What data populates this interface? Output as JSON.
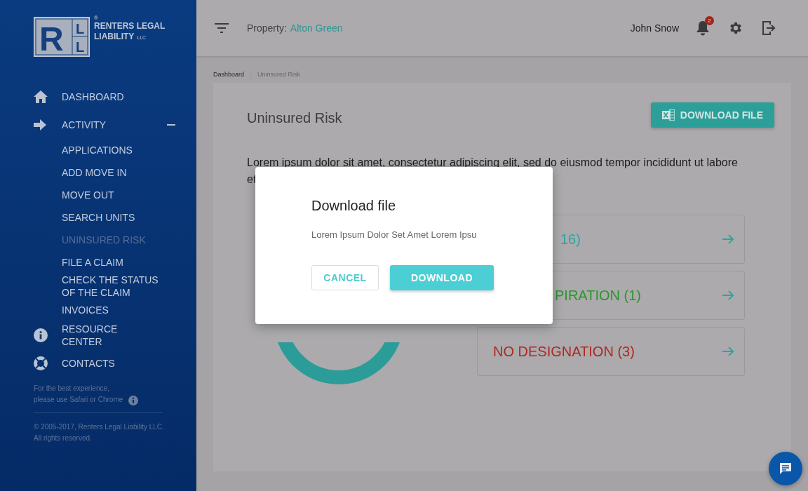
{
  "sidebar": {
    "logo": {
      "letters": [
        "R",
        "L",
        "L"
      ],
      "mark": "®",
      "name_lines": [
        "RENTERS LEGAL",
        "LIABILITY"
      ],
      "suffix": "LLC"
    },
    "nav": [
      {
        "label": "DASHBOARD"
      },
      {
        "label": "ACTIVITY",
        "expanded": true,
        "children": [
          {
            "label": "APPLICATIONS",
            "selected": false
          },
          {
            "label": "ADD MOVE IN",
            "selected": false
          },
          {
            "label": "MOVE OUT",
            "selected": false
          },
          {
            "label": "SEARCH UNITS",
            "selected": false
          },
          {
            "label": "UNINSURED RISK",
            "selected": true
          },
          {
            "label": "FILE A CLAIM",
            "selected": false
          },
          {
            "label": "CHECK THE STATUS OF THE CLAIM",
            "selected": false
          },
          {
            "label": "INVOICES",
            "selected": false
          }
        ]
      },
      {
        "label": "RESOURCE CENTER"
      },
      {
        "label": "CONTACTS"
      }
    ],
    "note": "For the best experience,\nplease use Safari or Chrome",
    "copyright": "© 2005-2017, Renters Legal Liability LLC.\nAll rights reserved."
  },
  "header": {
    "property_label": "Property:",
    "property_value": "Alton Green",
    "user": "John Snow",
    "notification_count": "2"
  },
  "breadcrumb": [
    {
      "label": "Dashboard",
      "selected": false
    },
    {
      "label": "Uninsured Risk",
      "selected": true
    }
  ],
  "page": {
    "title": "Uninsured Risk",
    "download_button": "DOWNLOAD FILE",
    "paragraph": "Lorem ipsum dolor sit amet, consectetur adipiscing elit, sed do eiusmod tempor incididunt ut labore et",
    "risk_cards": [
      {
        "label": "16)",
        "color": "#2fa39f"
      },
      {
        "label": "PIRATION (1)",
        "color": "#2b962b"
      },
      {
        "label": "NO DESIGNATION (3)",
        "color": "#ad2a20"
      }
    ]
  },
  "modal": {
    "title": "Download file",
    "message": "Lorem Ipsum Dolor Set Amet Lorem Ipsu",
    "buttons": [
      {
        "label": "CANCEL",
        "kind": "secondary"
      },
      {
        "label": "DOWNLOAD",
        "kind": "primary"
      }
    ]
  }
}
